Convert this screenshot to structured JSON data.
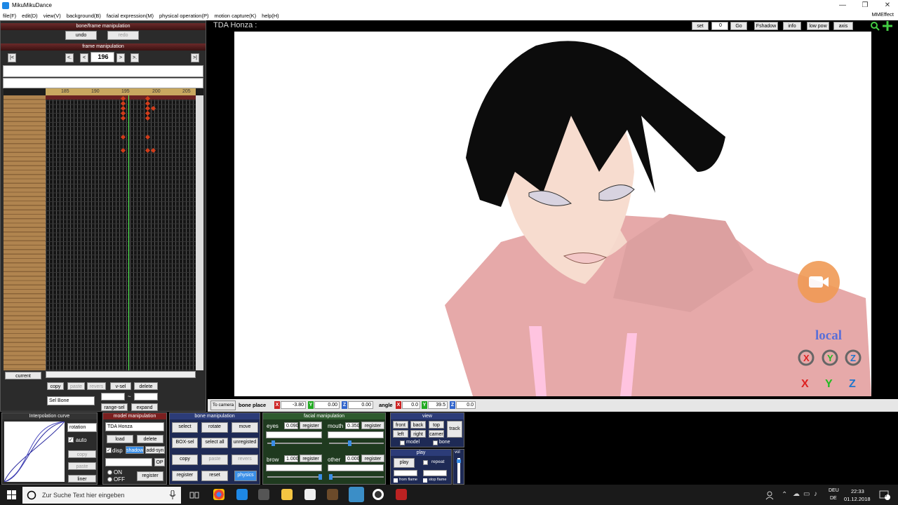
{
  "window": {
    "title": "MikuMikuDance",
    "minimize": "—",
    "maximize": "❐",
    "close": "✕"
  },
  "menu": [
    "file(F)",
    "edit(D)",
    "view(V)",
    "background(B)",
    "facial expression(M)",
    "physical operation(P)",
    "motion capture(K)",
    "help(H)"
  ],
  "menu_right": "MMEffect",
  "left": {
    "bone_frame_title": "bone/frame manipulation",
    "undo": "undo",
    "redo": "redo",
    "frame_title": "frame manipulation",
    "frame_value": "196",
    "nav": [
      "|<",
      "<.",
      "<",
      ">",
      ">.",
      ">|"
    ],
    "ruler": [
      "185",
      "190",
      "195",
      "200",
      "205"
    ],
    "current": "current",
    "copy": "copy",
    "paste": "paste",
    "reverse": "revers",
    "vsel": "v-sel",
    "delete": "delete",
    "select_value": "Sel Bone",
    "range_sel": "range-sel",
    "expand": "expand",
    "tilde": "~"
  },
  "viewport": {
    "model_title": "TDA Honza :",
    "set": "set",
    "frame_input": "0",
    "go": "Go",
    "fshadow": "Fshadow",
    "info": "info",
    "lowpow": "low pow",
    "axis": "axis",
    "local": "local"
  },
  "bone_bar": {
    "to_camera": "To camera",
    "bone_place": "bone place",
    "x": "-3.80",
    "y": "0.00",
    "z": "0.00",
    "angle": "angle",
    "ax": "0.0",
    "ay": "39.5",
    "az": "0.0"
  },
  "interp": {
    "title": "Interpolation curve",
    "select": "rotation",
    "auto": "auto",
    "copy": "copy",
    "paste": "paste",
    "liner": "liner"
  },
  "model": {
    "title": "model manipulation",
    "select": "TDA Honza",
    "load": "load",
    "delete": "delete",
    "disp": "disp",
    "shadow": "shadow",
    "addsyn": "add-syn",
    "op": "OP",
    "on": "ON",
    "off": "OFF",
    "register": "register"
  },
  "bone": {
    "title": "bone manipulation",
    "select": "select",
    "rotate": "rotate",
    "move": "move",
    "boxsel": "BOX-sel",
    "selectall": "select all",
    "unregisted": "unregisted",
    "copy": "copy",
    "paste": "paste",
    "reverse": "revers",
    "register": "register",
    "reset": "reset",
    "physics": "physics"
  },
  "facial": {
    "title": "facial manipulation",
    "eyes": "eyes",
    "eyes_val": "0.090",
    "mouth": "mouth",
    "mouth_val": "0.350",
    "brow": "brow",
    "brow_val": "1.000",
    "other": "other",
    "other_val": "0.000",
    "register": "register"
  },
  "view": {
    "title": "view",
    "front": "front",
    "back": "back",
    "top": "top",
    "track": "track",
    "left": "left",
    "right": "right",
    "camera": "camer",
    "model": "model",
    "bone": "bone"
  },
  "play": {
    "title": "play",
    "play": "play",
    "repeat": "repeat",
    "from_flame": "from flame",
    "stop_flame": "stop flame",
    "vol": "vol"
  },
  "taskbar": {
    "search": "Zur Suche Text hier eingeben",
    "lang1": "DEU",
    "lang2": "DE",
    "time": "22:33",
    "date": "01.12.2018",
    "badge": "3"
  },
  "colors": {
    "accent": "#1e88e5",
    "panel_dark": "#2b2b2b",
    "keyframe": "#d23c1a",
    "hoodie": "#e8b4b4"
  }
}
